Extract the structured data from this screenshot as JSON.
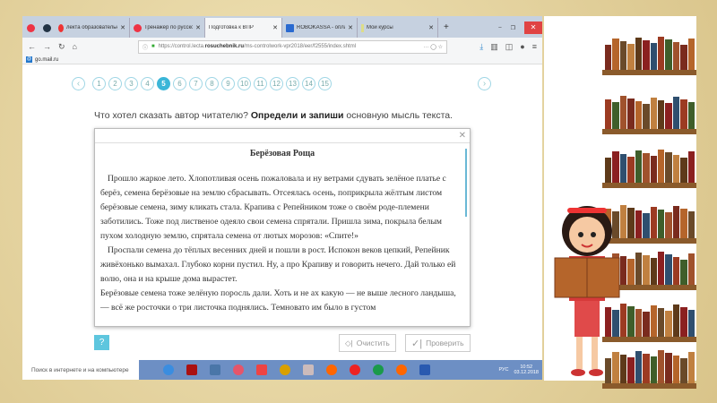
{
  "browser": {
    "tabs": [
      {
        "label": "лекта образовательная плат",
        "icon": "yandex-icon"
      },
      {
        "label": "Тренажер по русскому язы",
        "icon": "opera-icon"
      },
      {
        "label": "Подготовка к ВПР",
        "icon": "",
        "active": true
      },
      {
        "label": "ROBOKASSA - оплата банко",
        "icon": "robokassa-icon"
      },
      {
        "label": "Мои курсы",
        "icon": "page-icon"
      }
    ],
    "new_tab": "+",
    "url_prefix": "https://control.lecta.",
    "url_domain": "rosuchebnik.ru",
    "url_path": "/ms-controlwork-vpr2018/eer/f2555/index.shtml",
    "bookmark": "go.mail.ru"
  },
  "pager": {
    "pages": [
      "1",
      "2",
      "3",
      "4",
      "5",
      "6",
      "7",
      "8",
      "9",
      "10",
      "11",
      "12",
      "13",
      "14",
      "15"
    ],
    "current": "5",
    "prev": "‹",
    "next": "›"
  },
  "question": {
    "part1": "Что хотел сказать автор читателю? ",
    "bold": "Определи и запиши",
    "part2": " основную мысль текста."
  },
  "document": {
    "title": "Берёзовая Роща",
    "paragraphs": [
      "Прошло жаркое лето. Хлопотливая осень пожаловала и ну ветрами сдувать зелёное платье с берёз, семена берёзовые на землю сбрасывать. Отсеялась осень, поприкрыла жёлтым листом берёзовые семена, зиму кликать стала. Крапива с Репейником тоже о своём роде-племени заботились. Тоже под лиственое одеяло свои семена спрятали. Пришла зима, покрыла белым пухом холодную землю, спрятала семена от лютых морозов: «Спите!»",
      "Проспали семена до тёплых весенних дней и пошли в рост. Испокон веков цепкий, Репейник живёхонько вымахал. Глубоко корни пустил. Ну, а про Крапиву и говорить нечего. Дай только ей волю, она и на крыше дома вырастет.",
      "Берёзовые семена тоже зелёную поросль дали. Хоть и не ах какую — не выше лесного ландыша, — всё же росточки о три листочка поднялись. Темновато им было в густом"
    ]
  },
  "buttons": {
    "help": "?",
    "clear": "Очистить",
    "check": "Проверить"
  },
  "taskbar": {
    "search_placeholder": "Поиск в интернете и на компьютере",
    "lang": "РУС",
    "time": "10:52",
    "date": "03.12.2018"
  }
}
